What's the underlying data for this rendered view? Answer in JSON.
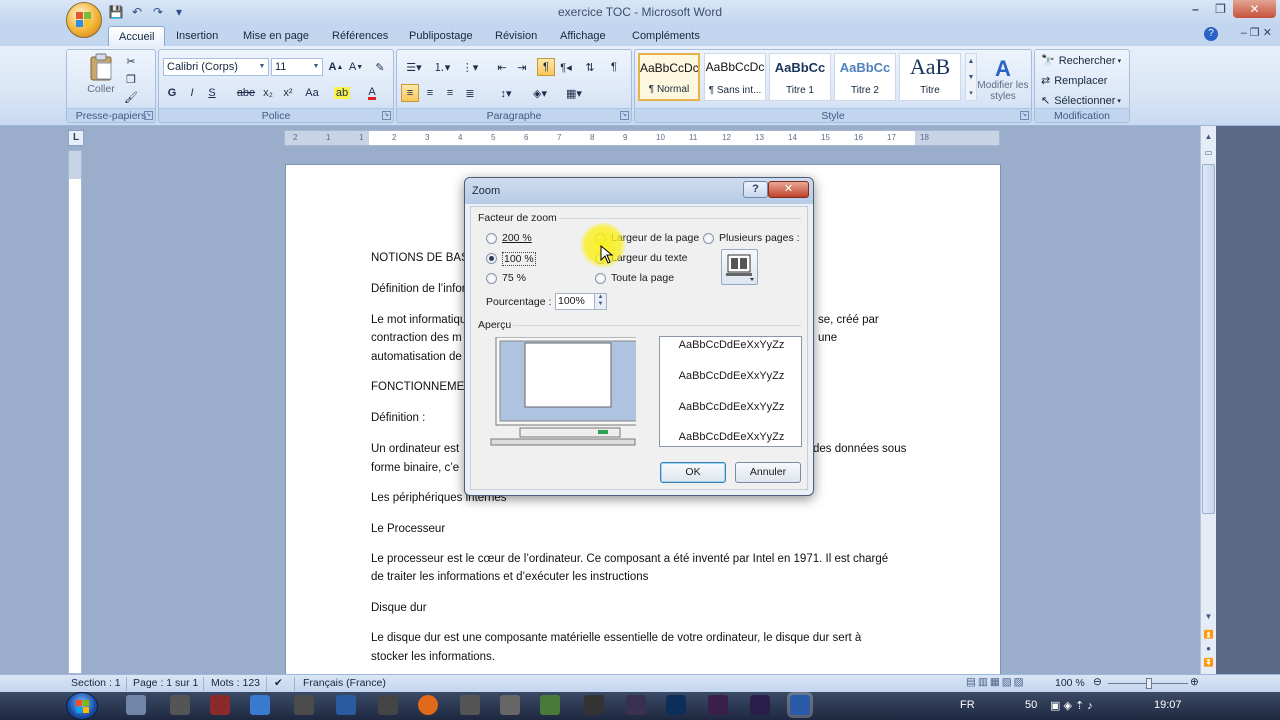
{
  "window": {
    "title": "exercice TOC - Microsoft Word"
  },
  "tabs": [
    "Accueil",
    "Insertion",
    "Mise en page",
    "Références",
    "Publipostage",
    "Révision",
    "Affichage",
    "Compléments"
  ],
  "ribbon": {
    "clipboard": {
      "label": "Presse-papiers",
      "paste": "Coller"
    },
    "font": {
      "label": "Police",
      "name": "Calibri (Corps)",
      "size": "11",
      "bold": "G",
      "italic": "I",
      "underline": "S",
      "strike": "abe",
      "subscript": "x₂",
      "superscript": "x²",
      "case": "Aa"
    },
    "paragraph": {
      "label": "Paragraphe"
    },
    "styles": {
      "label": "Style",
      "items": [
        {
          "sample": "AaBbCcDc",
          "name": "¶ Normal"
        },
        {
          "sample": "AaBbCcDc",
          "name": "¶ Sans int..."
        },
        {
          "sample": "AaBbCc",
          "name": "Titre 1"
        },
        {
          "sample": "AaBbCc",
          "name": "Titre 2"
        },
        {
          "sample": "AaB",
          "name": "Titre"
        }
      ],
      "modify": "Modifier les styles"
    },
    "editing": {
      "label": "Modification",
      "find": "Rechercher",
      "replace": "Remplacer",
      "select": "Sélectionner"
    }
  },
  "document": {
    "lines": [
      "NOTIONS DE BASE",
      "Définition de l’informatique",
      "Le mot informatique",
      "contraction des m",
      "automatisation de",
      "FONCTIONNEMENT",
      "Définition :",
      "Un ordinateur est",
      "forme binaire, c’e",
      "Les périphériques internes",
      "Le Processeur",
      "Le processeur est le cœur de l’ordinateur. Ce composant a été inventé par Intel en 1971.  Il est chargé",
      "de traiter les informations et d’exécuter les instructions",
      "Disque dur",
      "Le disque dur est une composante matérielle essentielle de votre ordinateur, le disque dur sert à",
      "stocker les informations."
    ],
    "right_fragments": [
      "se, créé par",
      "une",
      "des données sous"
    ]
  },
  "dialog": {
    "title": "Zoom",
    "help": "?",
    "close": "✕",
    "zoom_factor_label": "Facteur de zoom",
    "options": [
      "200 %",
      "100 %",
      "75 %",
      "Largeur de la page",
      "Largeur du texte",
      "Toute la page",
      "Plusieurs pages :"
    ],
    "selected_option": "100 %",
    "percentage_label": "Pourcentage :",
    "percentage_value": "100%",
    "preview_label": "Aperçu",
    "preview_text": [
      "AaBbCcDdEeXxYyZz",
      "AaBbCcDdEeXxYyZz",
      "AaBbCcDdEeXxYyZz",
      "AaBbCcDdEeXxYyZz"
    ],
    "ok": "OK",
    "cancel": "Annuler"
  },
  "statusbar": {
    "section": "Section : 1",
    "page": "Page : 1 sur 1",
    "words": "Mots : 123",
    "language": "Français (France)",
    "zoom": "100 %"
  },
  "taskbar": {
    "lang": "FR",
    "counter": "50",
    "time": "19:07"
  },
  "ruler_labels": [
    "2",
    "1",
    "1",
    "2",
    "3",
    "4",
    "5",
    "6",
    "7",
    "8",
    "9",
    "10",
    "11",
    "12",
    "13",
    "14",
    "15",
    "16",
    "17",
    "18"
  ],
  "colors": {
    "accent": "#2b62c6",
    "highlight": "#f9e54a",
    "ribbon": "#dae6f6"
  }
}
